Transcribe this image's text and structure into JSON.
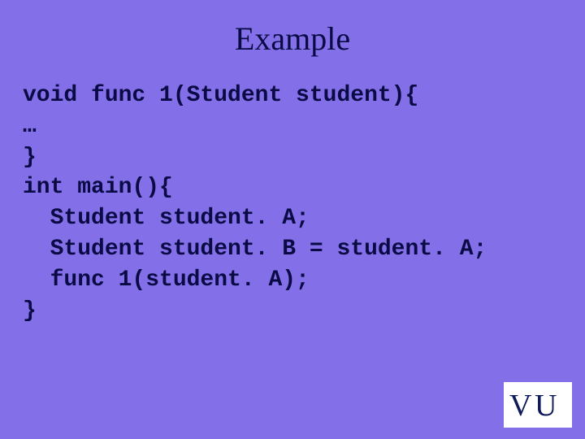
{
  "title": "Example",
  "code": {
    "l1": "void func 1(Student student){",
    "l2": "…",
    "l3": "}",
    "l4": "int main(){",
    "l5": "  Student student. A;",
    "l6": "  Student student. B = student. A;",
    "l7": "  func 1(student. A);",
    "l8": "}"
  },
  "logo": "VU"
}
